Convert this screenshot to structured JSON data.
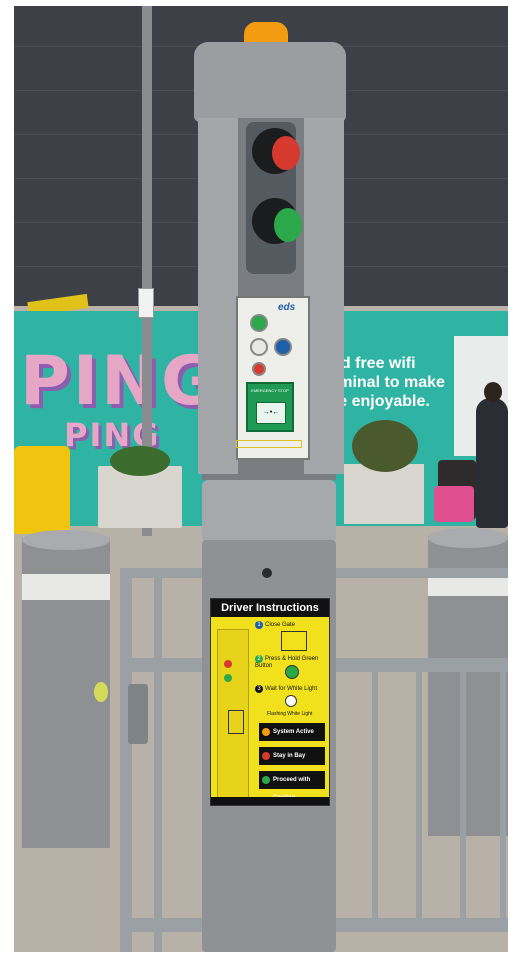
{
  "background_ad": {
    "brand_large": "PING",
    "brand_small": "PING",
    "lines": [
      "ed free wifi",
      "rminal to make",
      "re enjoyable."
    ]
  },
  "panel": {
    "logo": "eds",
    "call_point_label": "EMERGENCY STOP"
  },
  "instructions": {
    "title": "Driver Instructions",
    "steps": [
      {
        "num": "1",
        "text": "Close Gate"
      },
      {
        "num": "2",
        "text": "Press & Hold Green Button"
      },
      {
        "num": "3",
        "text": "Wait for White Light"
      }
    ],
    "note": "Flashing White Light",
    "statuses": [
      {
        "label": "System Active",
        "color": "#f39c12"
      },
      {
        "label": "Stay in Bay",
        "color": "#d63a2f"
      },
      {
        "label": "Proceed with Caution",
        "color": "#2aa84a"
      }
    ]
  },
  "colors": {
    "red_lamp": "#d63a2f",
    "green_lamp": "#2aa84a",
    "sign_yellow": "#f1e11c"
  }
}
